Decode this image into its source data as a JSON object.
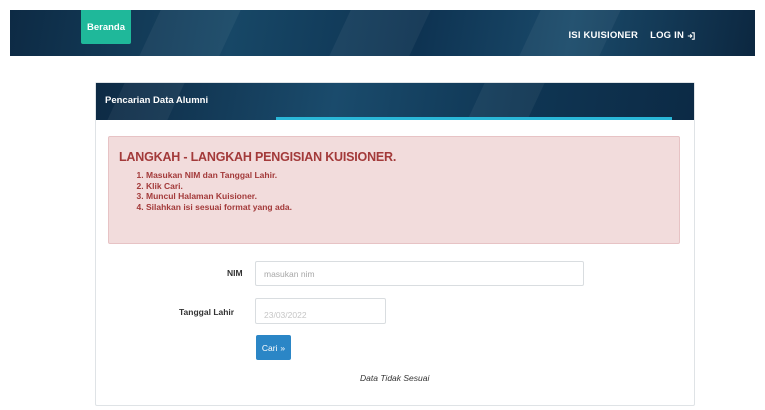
{
  "navbar": {
    "brand": "Beranda",
    "links": [
      {
        "label": "ISI KUISIONER"
      },
      {
        "label": "LOG IN",
        "icon": "login-icon"
      }
    ]
  },
  "panel": {
    "title": "Pencarian Data Alumni",
    "alert": {
      "title": "LANGKAH - LANGKAH PENGISIAN KUISIONER.",
      "steps": [
        "Masukan NIM dan Tanggal Lahir.",
        "Klik Cari.",
        "Muncul Halaman Kuisioner.",
        "Silahkan isi sesuai format yang ada."
      ]
    },
    "form": {
      "nim_label": "NIM",
      "nim_placeholder": "masukan nim",
      "nim_value": "",
      "dob_label": "Tanggal Lahir",
      "dob_value": "23/03/2022",
      "search_button": "Cari",
      "search_button_icon": "»",
      "status_text": "Data Tidak Sesuai"
    }
  },
  "colors": {
    "navbar": "#123a58",
    "brand": "#1fb89a",
    "alert_bg": "#f2dcdc",
    "alert_text": "#a33a3a",
    "button": "#2b86c6",
    "accent_line": "#2ab7d8"
  }
}
